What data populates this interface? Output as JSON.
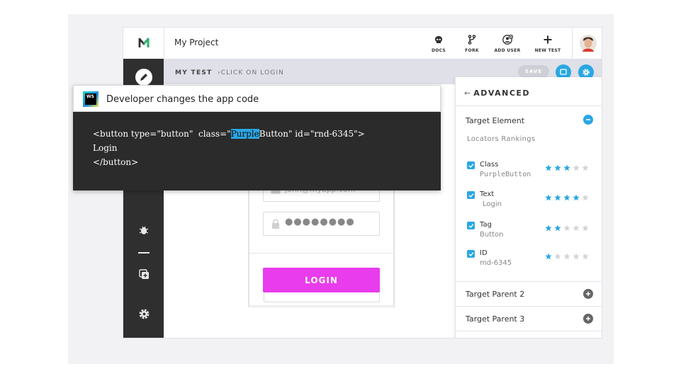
{
  "header": {
    "project_name": "My Project",
    "actions": [
      {
        "label": "DOCS",
        "icon": "docs-skull-icon"
      },
      {
        "label": "FORK",
        "icon": "fork-icon"
      },
      {
        "label": "ADD USER",
        "icon": "add-user-icon"
      },
      {
        "label": "NEW TEST",
        "icon": "plus-icon"
      }
    ]
  },
  "breadcrumb": {
    "test": "MY TEST",
    "separator": "›",
    "step": "CLICK ON LOGIN"
  },
  "toolbar": {
    "save_label": "SAVE"
  },
  "login_form": {
    "email_placeholder": "john@myapp.com",
    "password_mask": "●●●●●●●●",
    "login_label": "LOGIN"
  },
  "panel": {
    "back_arrow": "←",
    "title": "ADVANCED",
    "target_element": "Target Element",
    "rankings_label": "Locators Rankings",
    "locators": [
      {
        "name": "Class",
        "value": "PurpleButton",
        "rating": 3
      },
      {
        "name": "Text",
        "value": "Login",
        "rating": 4
      },
      {
        "name": "Tag",
        "value": "Button",
        "rating": 2
      },
      {
        "name": "ID",
        "value": "md-6345",
        "rating": 1
      }
    ],
    "target_parent_2": "Target Parent 2",
    "target_parent_3": "Target Parent 3"
  },
  "overlay": {
    "app_badge": "WS",
    "title": "Developer changes the app code",
    "code_pre": "<button type=\"button\"  class=\"",
    "code_highlight": "Purple",
    "code_post": "Button\" id=\"rnd-6345\">",
    "code_line2": "Login",
    "code_line3": "</button>"
  },
  "colors": {
    "accent": "#2aa7e3",
    "login_button": "#e93cec",
    "sidebar": "#2f2f2f",
    "code_background": "#2b2b2b",
    "logo_green": "#2bb673"
  }
}
